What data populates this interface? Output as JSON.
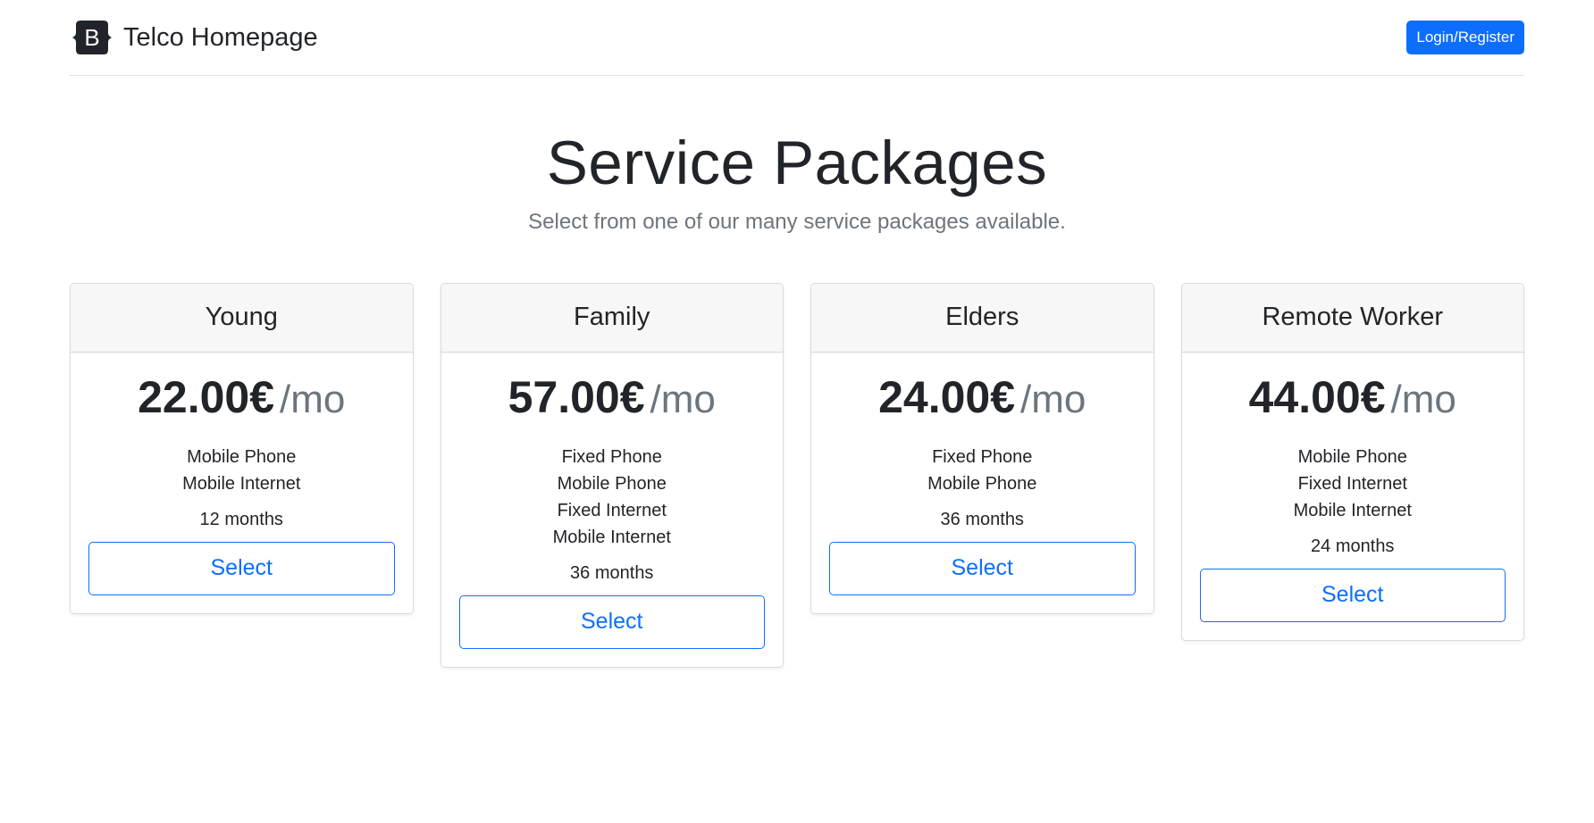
{
  "header": {
    "logo_letter": "B",
    "brand_name": "Telco Homepage",
    "login_label": "Login/Register"
  },
  "hero": {
    "title": "Service Packages",
    "subtitle": "Select from one of our many service packages available."
  },
  "packages": [
    {
      "name": "Young",
      "price": "22.00€",
      "unit": "/mo",
      "features": [
        "Mobile Phone",
        "Mobile Internet"
      ],
      "duration": "12 months",
      "button_label": "Select"
    },
    {
      "name": "Family",
      "price": "57.00€",
      "unit": "/mo",
      "features": [
        "Fixed Phone",
        "Mobile Phone",
        "Fixed Internet",
        "Mobile Internet"
      ],
      "duration": "36 months",
      "button_label": "Select"
    },
    {
      "name": "Elders",
      "price": "24.00€",
      "unit": "/mo",
      "features": [
        "Fixed Phone",
        "Mobile Phone"
      ],
      "duration": "36 months",
      "button_label": "Select"
    },
    {
      "name": "Remote Worker",
      "price": "44.00€",
      "unit": "/mo",
      "features": [
        "Mobile Phone",
        "Fixed Internet",
        "Mobile Internet"
      ],
      "duration": "24 months",
      "button_label": "Select"
    }
  ],
  "colors": {
    "primary": "#0d6efd",
    "text": "#212529",
    "muted": "#6c757d",
    "card_header_bg": "#f7f7f7",
    "logo_bg": "#212529"
  },
  "icons": {
    "brand_logo": "bootstrap-logo-icon"
  }
}
